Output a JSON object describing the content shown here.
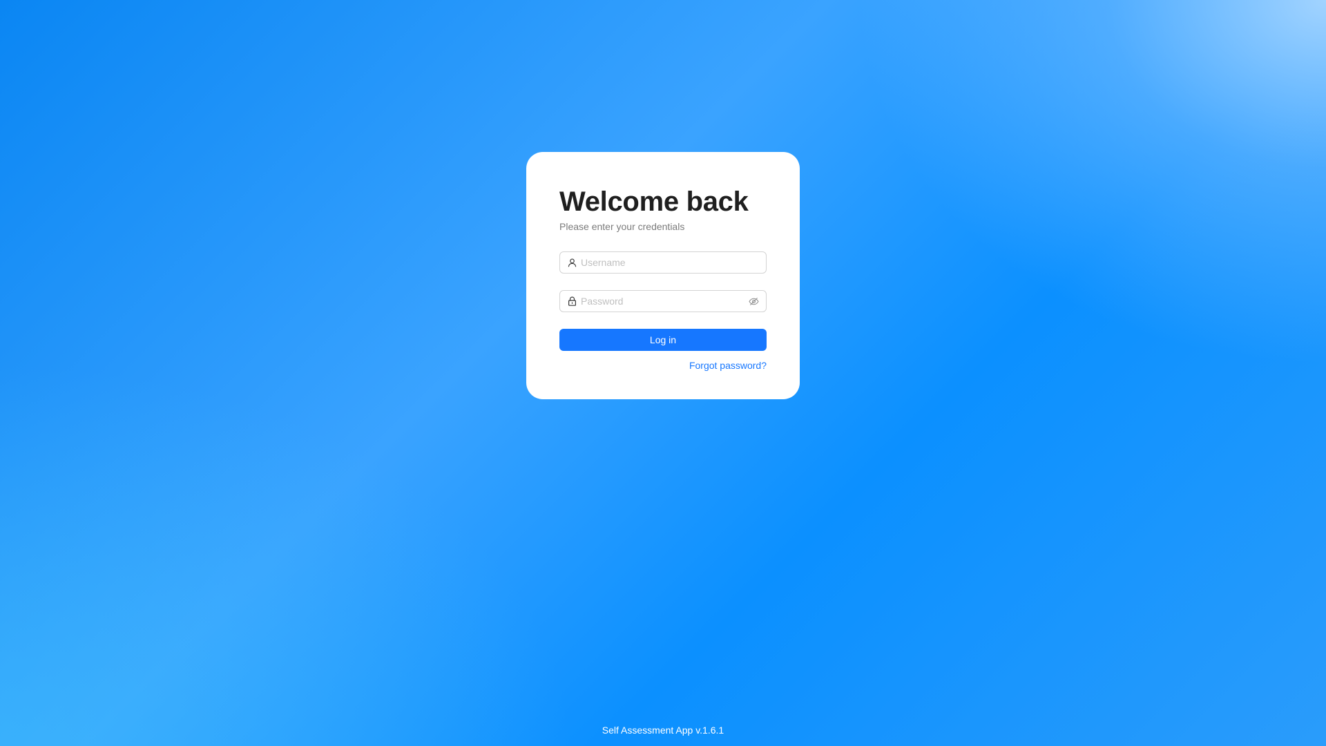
{
  "login": {
    "title": "Welcome back",
    "subtitle": "Please enter your credentials",
    "username": {
      "placeholder": "Username",
      "value": "",
      "icon": "user-icon"
    },
    "password": {
      "placeholder": "Password",
      "value": "",
      "icon": "lock-icon",
      "toggle_icon": "eye-invisible-icon"
    },
    "login_button_label": "Log in",
    "forgot_password_label": "Forgot password?"
  },
  "footer": {
    "version_text": "Self Assessment App v.1.6.1"
  },
  "colors": {
    "primary": "#1677ff",
    "card_background": "#ffffff",
    "title_text": "#1f1f1f",
    "subtitle_text": "#7a7a7a",
    "placeholder_text": "#bfbfbf"
  }
}
